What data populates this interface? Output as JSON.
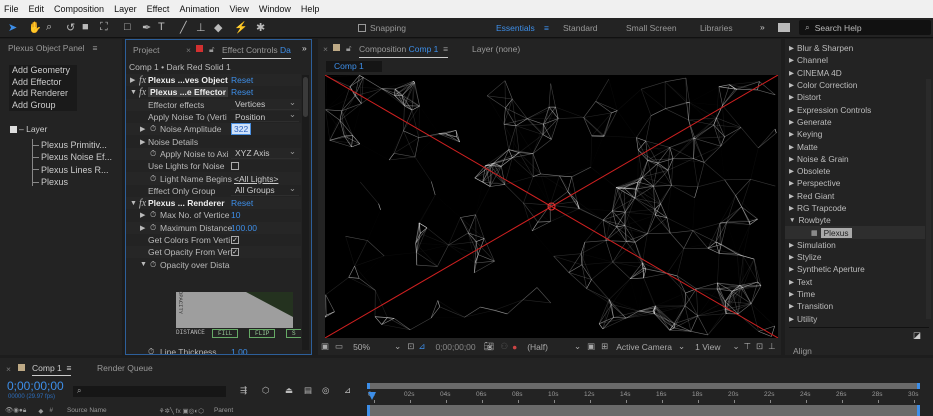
{
  "menu": [
    "File",
    "Edit",
    "Composition",
    "Layer",
    "Effect",
    "Animation",
    "View",
    "Window",
    "Help"
  ],
  "toolbar": {
    "snapping": "Snapping",
    "workspaces": [
      "Essentials",
      "Standard",
      "Small Screen",
      "Libraries"
    ],
    "search_placeholder": "Search Help"
  },
  "plexus_panel": {
    "title": "Plexus Object Panel",
    "buttons": [
      "Add Geometry",
      "Add Effector",
      "Add Renderer",
      "Add Group"
    ],
    "tree_root": "Layer",
    "tree_items": [
      "Plexus Primitiv...",
      "Plexus Noise Ef...",
      "Plexus Lines R...",
      "Plexus"
    ]
  },
  "effect_controls": {
    "tab_project": "Project",
    "tab_title": "Effect Controls",
    "tab_layer": "Da",
    "breadcrumb": "Comp 1 • Dark Red Solid 1",
    "reset": "Reset",
    "fx1": "Plexus ...ves Object",
    "fx2": "Plexus ...e Effector",
    "effector_effects": "Effector effects",
    "effector_effects_val": "Vertices",
    "apply_noise": "Apply Noise To (Verti",
    "apply_noise_val": "Position",
    "noise_amp": "Noise Amplitude",
    "noise_amp_val": "322",
    "noise_details": "Noise Details",
    "noise_axis": "Apply Noise to Axi",
    "noise_axis_val": "XYZ Axis",
    "use_lights": "Use Lights for Noise",
    "light_name": "Light Name Begins",
    "light_name_val": "<All Lights>",
    "effect_only": "Effect Only Group",
    "effect_only_val": "All Groups",
    "fx3": "Plexus ... Renderer",
    "max_vert": "Max No. of Vertice",
    "max_vert_val": "10",
    "max_dist": "Maximum Distance",
    "max_dist_val": "100.00",
    "get_colors": "Get Colors From Verti",
    "get_opacity": "Get Opacity From Vert",
    "opacity_dist": "Opacity over Dista",
    "graph_y": "OPACITY",
    "graph_x": "DISTANCE",
    "graph_btns": [
      "FILL",
      "FLIP",
      "S"
    ],
    "line_thick": "Line Thickness",
    "line_thick_val": "1.00"
  },
  "composition": {
    "tab": "Composition",
    "comp": "Comp 1",
    "layer_tab": "Layer (none)",
    "sub_tab": "Comp 1",
    "zoom": "50%",
    "timecode": "0;00;00;00",
    "resolution": "(Half)",
    "camera": "Active Camera",
    "views": "1 View"
  },
  "effects_list": {
    "items": [
      "Blur & Sharpen",
      "Channel",
      "CINEMA 4D",
      "Color Correction",
      "Distort",
      "Expression Controls",
      "Generate",
      "Keying",
      "Matte",
      "Noise & Grain",
      "Obsolete",
      "Perspective",
      "Red Giant",
      "RG Trapcode",
      "Rowbyte",
      "Simulation",
      "Stylize",
      "Synthetic Aperture",
      "Text",
      "Time",
      "Transition",
      "Utility"
    ],
    "open": "Rowbyte",
    "child": "Plexus",
    "align": "Align"
  },
  "timeline": {
    "tab": "Comp 1",
    "render_queue": "Render Queue",
    "timecode": "0;00;00;00",
    "fps": "00000 (29.97 fps)",
    "col_source": "Source Name",
    "col_parent": "Parent",
    "col_num": "#",
    "ticks": [
      "0s",
      "02s",
      "04s",
      "06s",
      "08s",
      "10s",
      "12s",
      "14s",
      "16s",
      "18s",
      "20s",
      "22s",
      "24s",
      "26s",
      "28s",
      "30s"
    ]
  },
  "colors": {
    "accent": "#3d8ee8",
    "panel": "#232323",
    "cross": "#d02020"
  }
}
